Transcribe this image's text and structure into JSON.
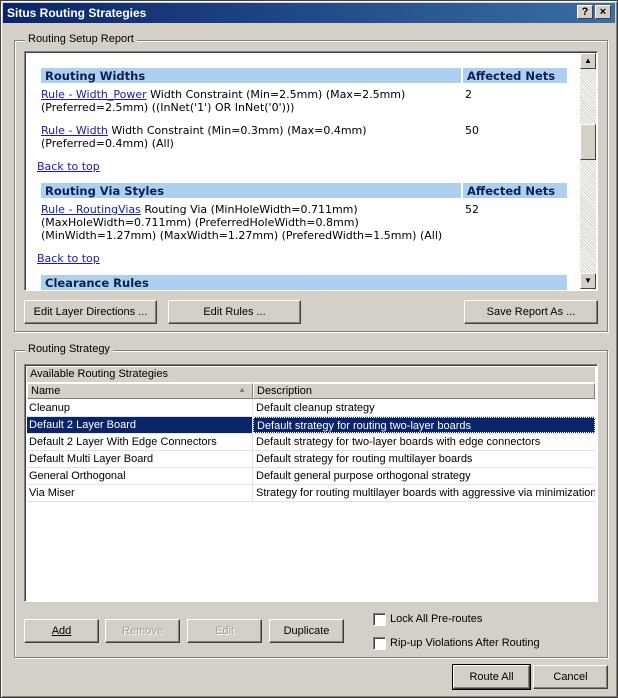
{
  "window": {
    "title": "Situs Routing Strategies",
    "help_label": "?",
    "close_label": "×"
  },
  "setup_group": {
    "title": "Routing Setup Report"
  },
  "report": {
    "sections": [
      {
        "heading": "Routing Widths",
        "nets_heading": "Affected Nets",
        "rules": [
          {
            "link": "Rule - Width_Power",
            "text": " Width Constraint (Min=2.5mm) (Max=2.5mm) (Preferred=2.5mm) ((InNet('1') OR InNet('0')))",
            "nets": "2"
          },
          {
            "link": "Rule - Width",
            "text": " Width Constraint (Min=0.3mm) (Max=0.4mm) (Preferred=0.4mm) (All)",
            "nets": "50"
          }
        ],
        "back_to_top": "Back to top"
      },
      {
        "heading": "Routing Via Styles",
        "nets_heading": "Affected Nets",
        "rules": [
          {
            "link": "Rule - RoutingVias",
            "text": " Routing Via (MinHoleWidth=0.711mm) (MaxHoleWidth=0.711mm) (PreferredHoleWidth=0.8mm) (MinWidth=1.27mm) (MaxWidth=1.27mm) (PreferedWidth=1.5mm) (All)",
            "nets": "52"
          }
        ],
        "back_to_top": "Back to top"
      },
      {
        "heading": "Clearance Rules"
      }
    ]
  },
  "report_buttons": {
    "edit_layer_directions": "Edit Layer Directions ...",
    "edit_rules": "Edit Rules ...",
    "save_report": "Save Report As ..."
  },
  "strategy_group": {
    "title": "Routing Strategy"
  },
  "strategies": {
    "caption": "Available Routing Strategies",
    "columns": [
      "Name",
      "Description"
    ],
    "rows": [
      {
        "name": "Cleanup",
        "description": "Default cleanup strategy",
        "selected": false
      },
      {
        "name": "Default 2 Layer Board",
        "description": "Default strategy for routing two-layer boards",
        "selected": true
      },
      {
        "name": "Default 2 Layer With Edge Connectors",
        "description": "Default strategy for two-layer boards with edge connectors",
        "selected": false
      },
      {
        "name": "Default Multi Layer Board",
        "description": "Default strategy for routing multilayer boards",
        "selected": false
      },
      {
        "name": "General Orthogonal",
        "description": "Default general purpose orthogonal strategy",
        "selected": false
      },
      {
        "name": "Via Miser",
        "description": "Strategy for routing multilayer boards with aggressive via minimization",
        "selected": false
      }
    ]
  },
  "strategy_buttons": {
    "add": "Add",
    "remove": "Remove",
    "edit": "Edit",
    "duplicate": "Duplicate"
  },
  "options": {
    "lock_preroutes": {
      "label": "Lock All Pre-routes",
      "checked": false
    },
    "ripup_violations": {
      "label": "Rip-up Violations After Routing",
      "checked": false
    }
  },
  "footer": {
    "route_all": "Route All",
    "cancel": "Cancel"
  }
}
